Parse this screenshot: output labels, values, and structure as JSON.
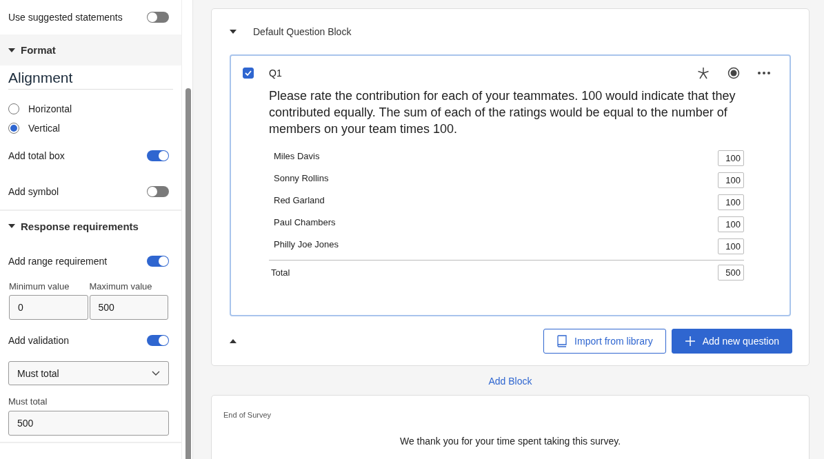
{
  "sidebar": {
    "items": [
      {
        "kind": "toggle",
        "label": "Use suggested statements",
        "on": false
      },
      {
        "kind": "section",
        "label": "Format",
        "expanded": true
      },
      {
        "kind": "heading",
        "label": "Alignment"
      },
      {
        "kind": "radio",
        "label": "Horizontal",
        "selected": false
      },
      {
        "kind": "radio",
        "label": "Vertical",
        "selected": true
      },
      {
        "kind": "toggle",
        "label": "Add total box",
        "on": true
      },
      {
        "kind": "toggle",
        "label": "Add symbol",
        "on": false
      },
      {
        "kind": "section",
        "label": "Response requirements",
        "expanded": true
      },
      {
        "kind": "toggle",
        "label": "Add range requirement",
        "on": true
      },
      {
        "kind": "range",
        "fields": [
          {
            "label": "Minimum value",
            "value": "0"
          },
          {
            "label": "Maximum value",
            "value": "500"
          }
        ]
      },
      {
        "kind": "toggle",
        "label": "Add validation",
        "on": true
      },
      {
        "kind": "select",
        "value": "Must total"
      },
      {
        "kind": "field",
        "label": "Must total",
        "value": "500"
      }
    ]
  },
  "block": {
    "title": "Default Question Block",
    "expanded": true,
    "question": {
      "number": "Q1",
      "checked": true,
      "text": "Please rate the contribution for each of your teammates. 100 would indicate that they contributed equally. The sum of each of the ratings would be equal to the number of members on your team times 100.",
      "rows": [
        {
          "label": "Miles Davis",
          "value": "100"
        },
        {
          "label": "Sonny Rollins",
          "value": "100"
        },
        {
          "label": "Red Garland",
          "value": "100"
        },
        {
          "label": "Paul Chambers",
          "value": "100"
        },
        {
          "label": "Philly Joe Jones",
          "value": "100"
        }
      ],
      "total": {
        "label": "Total",
        "value": "500"
      }
    },
    "buttons": [
      {
        "kind": "outline",
        "label": "Import from library"
      },
      {
        "kind": "primary",
        "label": "Add new question"
      }
    ]
  },
  "add_block": "Add Block",
  "end_block": {
    "title": "End of Survey",
    "message": "We thank you for your time spent taking this survey."
  }
}
